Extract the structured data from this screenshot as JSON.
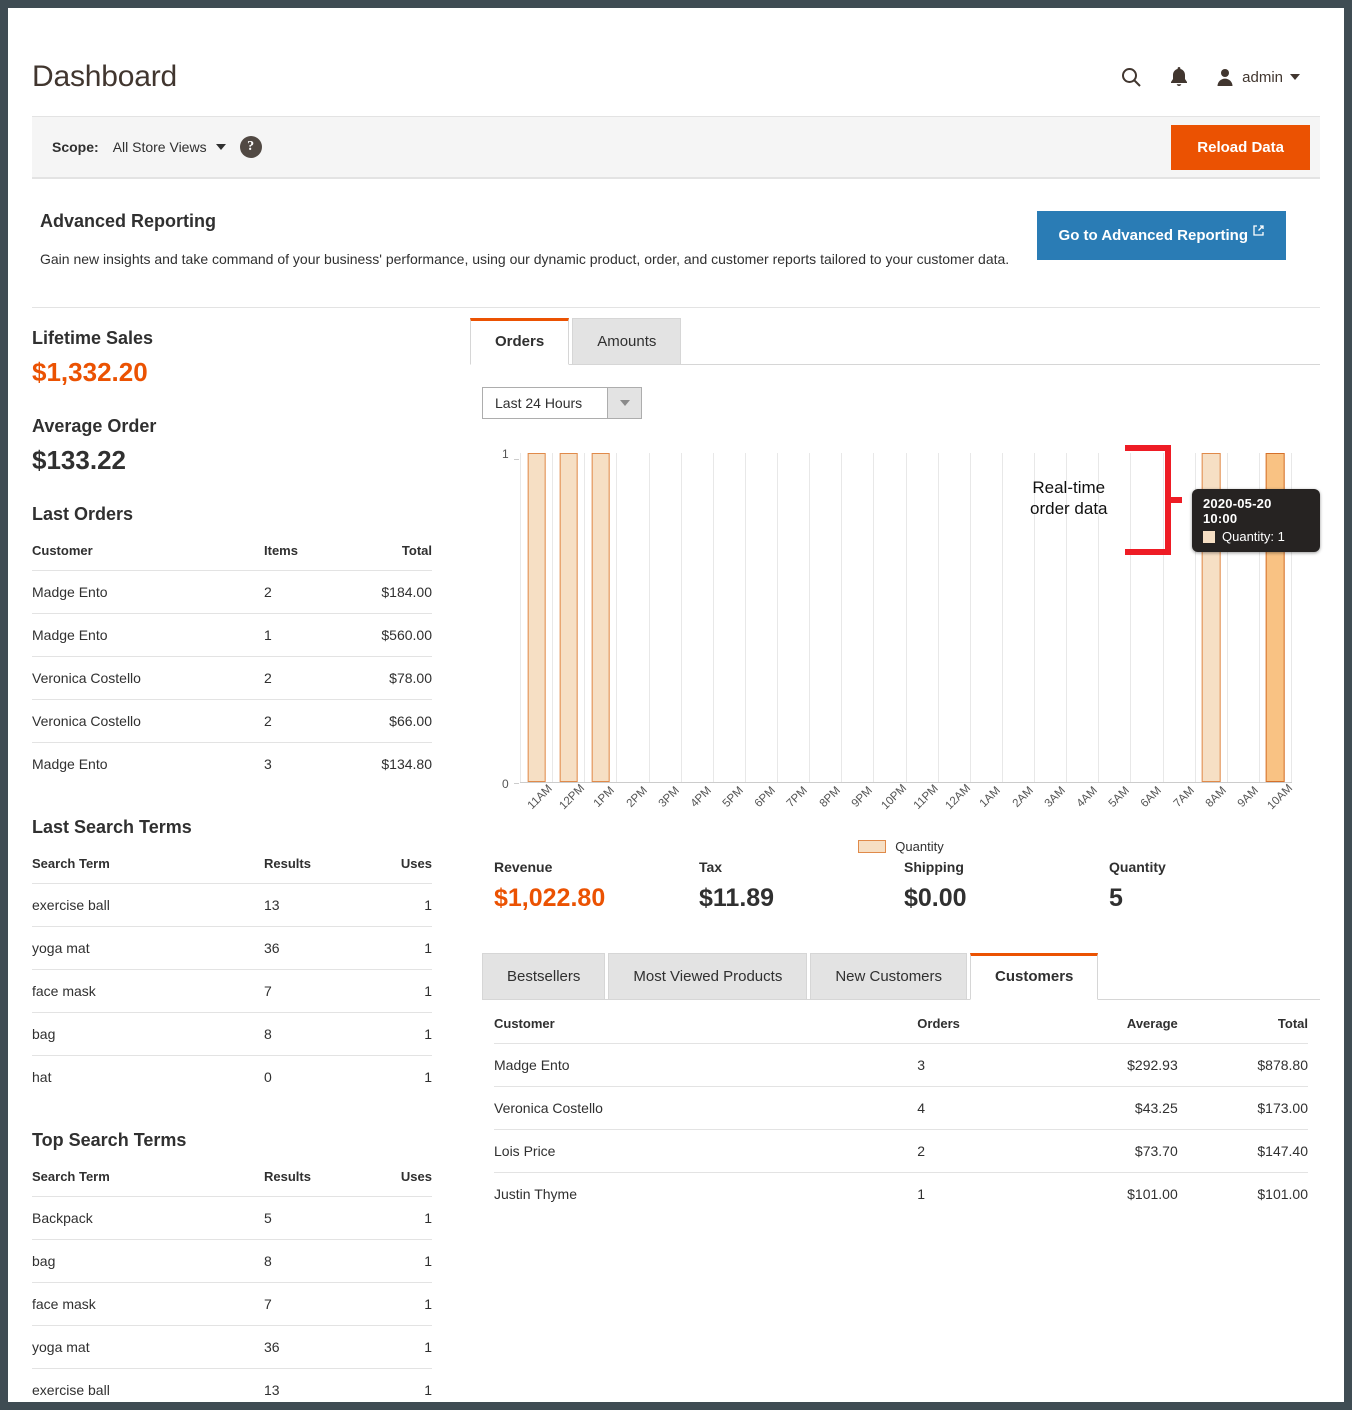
{
  "header": {
    "title": "Dashboard",
    "search_icon": "search-icon",
    "notification_icon": "bell-icon",
    "user_icon": "user-avatar-icon",
    "admin_label": "admin"
  },
  "scope": {
    "label": "Scope:",
    "value": "All Store Views",
    "help_glyph": "?",
    "reload_label": "Reload Data"
  },
  "advanced_reporting": {
    "title": "Advanced Reporting",
    "description": "Gain new insights and take command of your business' performance, using our dynamic product, order, and customer reports tailored to your customer data.",
    "button_label": "Go to Advanced Reporting",
    "external_glyph": "↗"
  },
  "sidebar": {
    "lifetime_sales_label": "Lifetime Sales",
    "lifetime_sales_value": "$1,332.20",
    "average_order_label": "Average Order",
    "average_order_value": "$133.22",
    "last_orders": {
      "title": "Last Orders",
      "columns": [
        "Customer",
        "Items",
        "Total"
      ],
      "rows": [
        [
          "Madge Ento",
          "2",
          "$184.00"
        ],
        [
          "Madge Ento",
          "1",
          "$560.00"
        ],
        [
          "Veronica Costello",
          "2",
          "$78.00"
        ],
        [
          "Veronica Costello",
          "2",
          "$66.00"
        ],
        [
          "Madge Ento",
          "3",
          "$134.80"
        ]
      ]
    },
    "last_search_terms": {
      "title": "Last Search Terms",
      "columns": [
        "Search Term",
        "Results",
        "Uses"
      ],
      "rows": [
        [
          "exercise ball",
          "13",
          "1"
        ],
        [
          "yoga mat",
          "36",
          "1"
        ],
        [
          "face mask",
          "7",
          "1"
        ],
        [
          "bag",
          "8",
          "1"
        ],
        [
          "hat",
          "0",
          "1"
        ]
      ]
    },
    "top_search_terms": {
      "title": "Top Search Terms",
      "columns": [
        "Search Term",
        "Results",
        "Uses"
      ],
      "rows": [
        [
          "Backpack",
          "5",
          "1"
        ],
        [
          "bag",
          "8",
          "1"
        ],
        [
          "face mask",
          "7",
          "1"
        ],
        [
          "yoga mat",
          "36",
          "1"
        ],
        [
          "exercise ball",
          "13",
          "1"
        ]
      ]
    }
  },
  "chart_tabs": [
    {
      "label": "Orders",
      "active": true
    },
    {
      "label": "Amounts",
      "active": false
    }
  ],
  "period": {
    "value": "Last 24 Hours"
  },
  "annotation": {
    "text": "Real-time\norder data",
    "color": "#ee1c25"
  },
  "tooltip": {
    "title": "2020-05-20 10:00",
    "series_label": "Quantity: 1"
  },
  "totals": [
    {
      "label": "Revenue",
      "value": "$1,022.80",
      "accent": true
    },
    {
      "label": "Tax",
      "value": "$11.89",
      "accent": false
    },
    {
      "label": "Shipping",
      "value": "$0.00",
      "accent": false
    },
    {
      "label": "Quantity",
      "value": "5",
      "accent": false
    }
  ],
  "bottom_tabs": [
    {
      "label": "Bestsellers",
      "active": false
    },
    {
      "label": "Most Viewed Products",
      "active": false
    },
    {
      "label": "New Customers",
      "active": false
    },
    {
      "label": "Customers",
      "active": true
    }
  ],
  "customers_table": {
    "columns": [
      "Customer",
      "Orders",
      "Average",
      "Total"
    ],
    "rows": [
      [
        "Madge Ento",
        "3",
        "$292.93",
        "$878.80"
      ],
      [
        "Veronica Costello",
        "4",
        "$43.25",
        "$173.00"
      ],
      [
        "Lois Price",
        "2",
        "$73.70",
        "$147.40"
      ],
      [
        "Justin Thyme",
        "1",
        "$101.00",
        "$101.00"
      ]
    ]
  },
  "colors": {
    "accent_orange": "#eb5202",
    "link_blue": "#2a7cb5",
    "bar_fill": "#f6dfc4",
    "bar_stroke": "#e08a4a",
    "bar_hover_fill": "#f9c283",
    "annotation_red": "#ee1c25"
  },
  "chart_data": {
    "type": "bar",
    "title": "",
    "xlabel": "",
    "ylabel": "",
    "ylim": [
      0,
      1
    ],
    "yticks": [
      "0",
      "1"
    ],
    "grid": true,
    "legend": {
      "position": "bottom",
      "entries": [
        "Quantity"
      ]
    },
    "categories": [
      "11AM",
      "12PM",
      "1PM",
      "2PM",
      "3PM",
      "4PM",
      "5PM",
      "6PM",
      "7PM",
      "8PM",
      "9PM",
      "10PM",
      "11PM",
      "12AM",
      "1AM",
      "2AM",
      "3AM",
      "4AM",
      "5AM",
      "6AM",
      "7AM",
      "8AM",
      "9AM",
      "10AM"
    ],
    "series": [
      {
        "name": "Quantity",
        "values": [
          1,
          1,
          1,
          0,
          0,
          0,
          0,
          0,
          0,
          0,
          0,
          0,
          0,
          0,
          0,
          0,
          0,
          0,
          0,
          0,
          0,
          1,
          0,
          1
        ]
      }
    ],
    "highlighted_category": "10AM",
    "annotations": [
      {
        "text": "Real-time order data",
        "color": "#ee1c25"
      },
      {
        "text": "2020-05-20 10:00 Quantity: 1",
        "type": "tooltip"
      }
    ]
  }
}
